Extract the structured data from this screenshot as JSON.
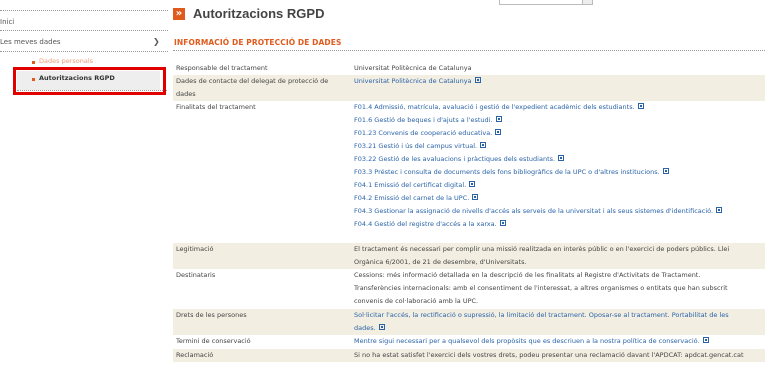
{
  "sidebar": {
    "items": [
      {
        "label": "Inici"
      },
      {
        "label": "Les meves dades"
      }
    ],
    "sub_items": [
      {
        "label": "Dades personals"
      },
      {
        "label": "Autoritzacions RGPD"
      }
    ]
  },
  "main": {
    "title": "Autoritzacions RGPD",
    "section_title": "INFORMACIÓ DE PROTECCIÓ DE DADES",
    "rows": [
      {
        "label": "Responsable del tractament",
        "lines": [
          "Universitat Politècnica de Catalunya"
        ]
      },
      {
        "label": "Dades de contacte del delegat de protecció de dades",
        "lines": [
          "Universitat Politècnica de Catalunya"
        ]
      },
      {
        "label": "Finalitats del tractament",
        "lines": [
          "F01.4 Admissió, matrícula, avaluació i gestió de l'expedient acadèmic dels estudiants.",
          "F01.6 Gestió de beques i d'ajuts a l'estudi.",
          "F01.23 Convenis de cooperació educativa.",
          "F03.21 Gestió i ús del campus virtual.",
          "F03.22 Gestió de les avaluacions i pràctiques dels estudiants.",
          "F03.3 Préstec i consulta de documents dels fons bibliogràfics de la UPC o d'altres institucions.",
          "F04.1 Emissió del certificat digital.",
          "F04.2 Emissió del carnet de la UPC.",
          "F04.3 Gestionar la assignació de nivells d'accés als serveis de la universitat i als seus sistemes d'identificació.",
          "F04.4 Gestió del registre d'accés a la xarxa."
        ]
      },
      {
        "label": "Legitimació",
        "lines": [
          "El tractament és necessari per complir una missió realitzada en interès públic o en l'exercici de poders públics. Llei",
          "Orgànica 6/2001, de 21 de desembre, d'Universitats."
        ]
      },
      {
        "label": "Destinataris",
        "lines": [
          "Cessions: més informació detallada en la descripció de les finalitats al Registre d'Activitats de Tractament.",
          "Transferències internacionals: amb el consentiment de l'interessat, a altres organismes o entitats que han subscrit",
          "convenis de col·laboració amb la UPC."
        ]
      },
      {
        "label": "Drets de les persones",
        "lines": [
          "Sol·licitar l'accés, la rectificació o supressió, la limitació del tractament. Oposar-se al tractament. Portabilitat de les",
          "dades."
        ]
      },
      {
        "label": "Termini de conservació",
        "lines": [
          "Mentre sigui necessari per a qualsevol dels propòsits que es descriuen a la nostra política de conservació."
        ]
      },
      {
        "label": "Reclamació",
        "lines": [
          "Si no ha estat satisfet l'exercici dels vostres drets, podeu presentar una reclamació davant l'APDCAT: apdcat.gencat.cat"
        ]
      }
    ]
  },
  "colors": {
    "accent": "#e05a1c",
    "link": "#2a63a8",
    "highlight_row": "#f3eee2",
    "annotation_box": "#e00000"
  }
}
